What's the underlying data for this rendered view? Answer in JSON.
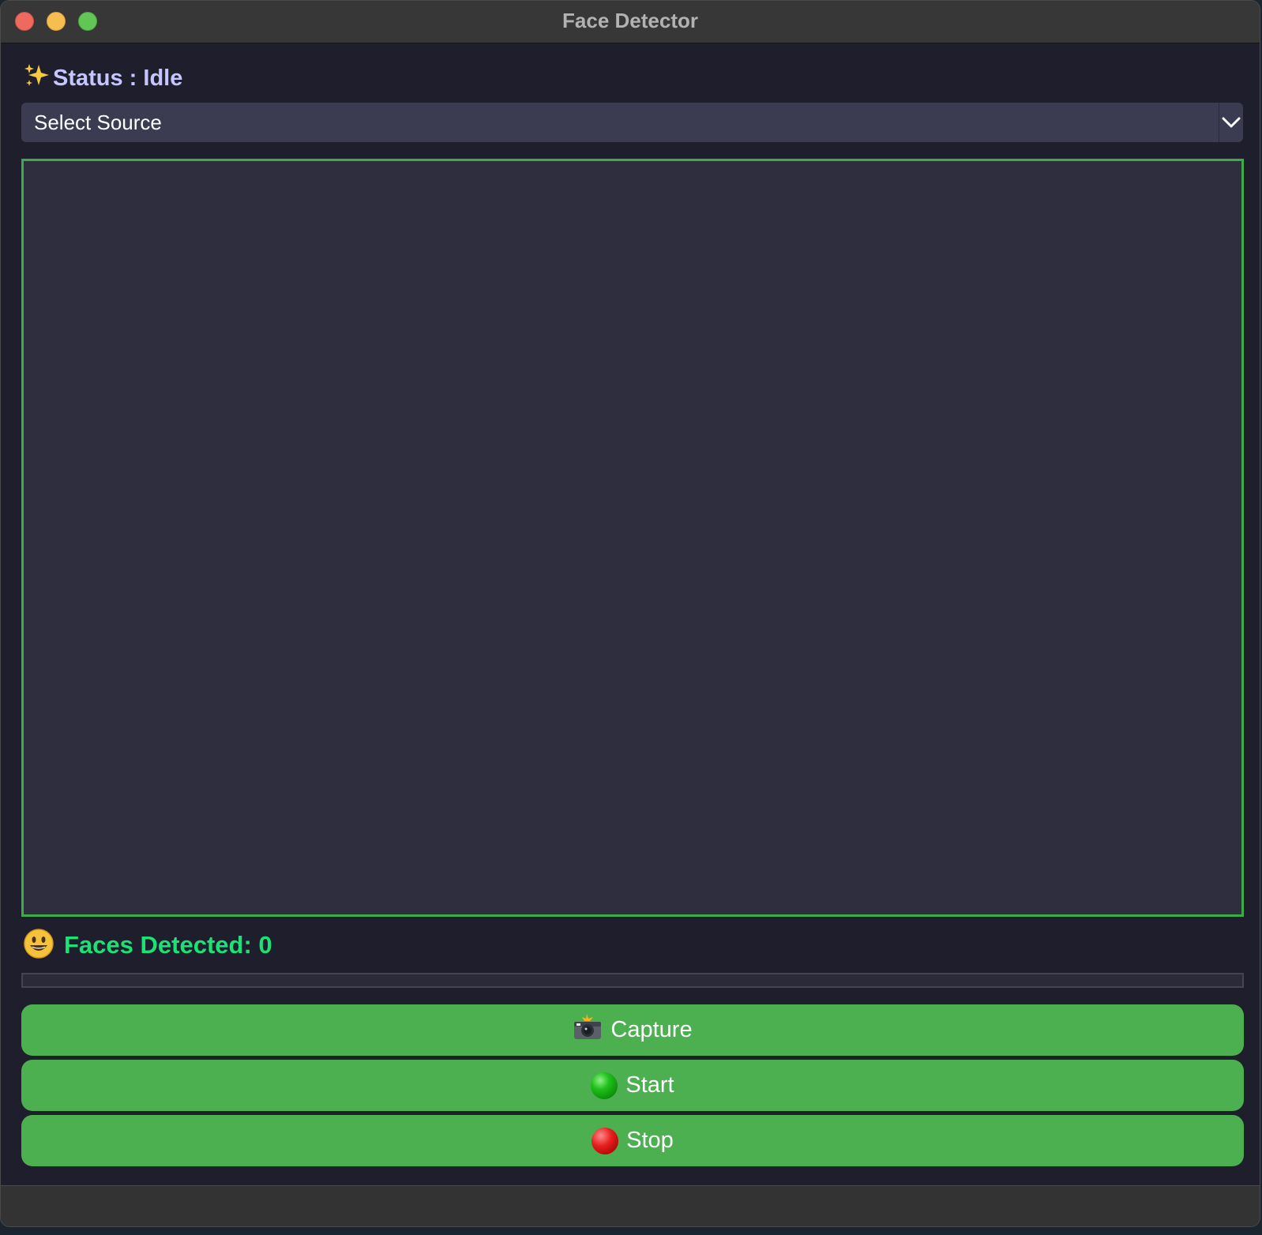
{
  "window": {
    "title": "Face Detector"
  },
  "status": {
    "icon": "sparkles-icon",
    "text": "Status : Idle"
  },
  "source_select": {
    "selected": "Select Source",
    "icon": "chevron-down-icon"
  },
  "faces": {
    "icon": "smiley-face-icon",
    "text": "Faces Detected: 0"
  },
  "progress": {
    "value": 0
  },
  "buttons": {
    "capture": {
      "icon": "camera-flash-icon",
      "label": "Capture"
    },
    "start": {
      "icon": "green-circle-icon",
      "label": "Start"
    },
    "stop": {
      "icon": "red-circle-icon",
      "label": "Stop"
    }
  },
  "colors": {
    "accent": "#4caf50",
    "faces_text": "#1be274",
    "status_text": "#c5c6ff",
    "video_border": "#3dab47"
  }
}
